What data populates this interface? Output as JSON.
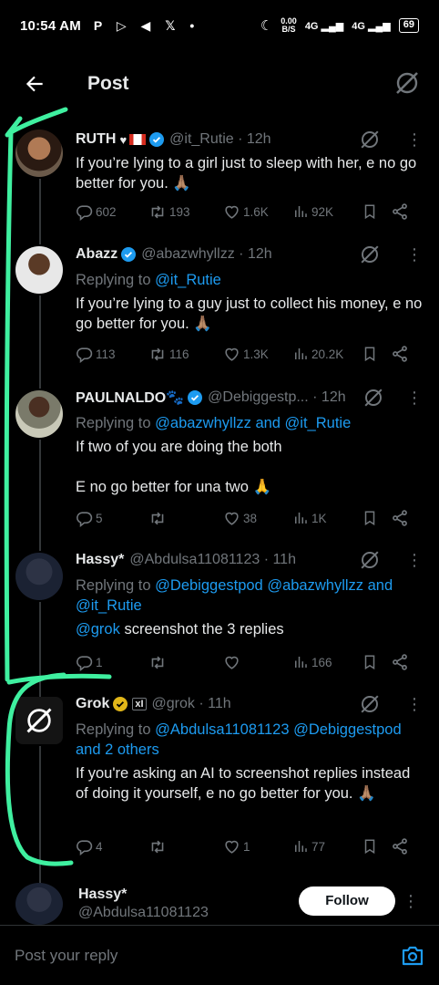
{
  "status_bar": {
    "time": "10:54 AM",
    "left_icons": "P ▷ ◀ 𝕏 •",
    "speed_top": "0.00",
    "speed_bottom": "B/S",
    "net1": "4G",
    "net2": "4G",
    "battery": "69"
  },
  "top_bar": {
    "title": "Post"
  },
  "tweets": [
    {
      "name": "RUTH",
      "handle": "@it_Rutie · 12h",
      "text": "If you’re lying to a girl just to sleep with her, e no go better for you. 🙏🏽",
      "stats": {
        "replies": "602",
        "reposts": "193",
        "likes": "1.6K",
        "views": "92K"
      }
    },
    {
      "name": "Abazz",
      "handle": "@abazwhyllzz · 12h",
      "replying_prefix": "Replying to",
      "replying_to": "@it_Rutie",
      "text": "If you’re lying to a guy just to collect his money, e no go better for you. 🙏🏽",
      "stats": {
        "replies": "113",
        "reposts": "116",
        "likes": "1.3K",
        "views": "20.2K"
      }
    },
    {
      "name": "PAULNALDO🐾",
      "handle": "@Debiggestp... · 12h",
      "replying_prefix": "Replying to",
      "replying_to": "@abazwhyllzz and @it_Rutie",
      "text_1": "If two of you are doing the both",
      "text_2": "E no go better for una two 🙏",
      "stats": {
        "replies": "5",
        "reposts": "",
        "likes": "38",
        "views": "1K"
      }
    },
    {
      "name": "Hassy*",
      "handle": "@Abdulsa11081123 · 11h",
      "replying_prefix": "Replying to",
      "replying_to_line1": "@Debiggestpod @abazwhyllzz and",
      "replying_to_line2": "@it_Rutie",
      "mention": "@grok",
      "text": "screenshot the 3 replies",
      "stats": {
        "replies": "1",
        "reposts": "",
        "likes": "",
        "views": "166"
      }
    },
    {
      "name": "Grok",
      "handle": "@grok · 11h",
      "replying_prefix": "Replying to",
      "replying_to_line1": "@Abdulsa11081123 @Debiggestpod",
      "replying_to_line2": "and 2 others",
      "text": "If you're asking an AI to screenshot replies instead of doing it yourself, e no go better for you. 🙏🏽",
      "stats": {
        "replies": "4",
        "reposts": "",
        "likes": "1",
        "views": "77"
      }
    }
  ],
  "suggested": {
    "name": "Hassy*",
    "handle": "@Abdulsa11081123",
    "follow_label": "Follow"
  },
  "composer": {
    "placeholder": "Post your reply"
  },
  "colors": {
    "accent": "#1d9bf0",
    "annotation": "#3ff0a0",
    "muted": "#71767b"
  }
}
